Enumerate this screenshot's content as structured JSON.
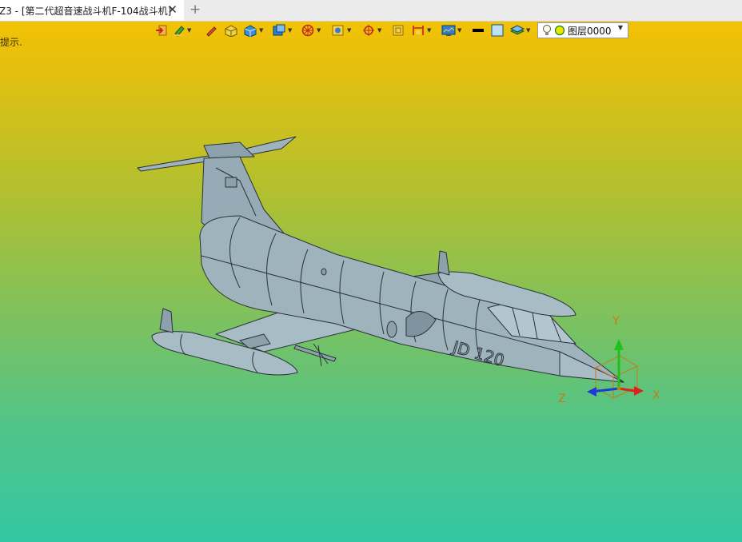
{
  "window": {
    "tab_title": "Z3 - [第二代超音速战斗机F-104战斗机]",
    "close_glyph": "✕",
    "new_tab_glyph": "+"
  },
  "prompt": {
    "text": "提示."
  },
  "toolbar": {
    "icons": [
      "exit-icon",
      "sketch-icon",
      "pen-icon",
      "box-icon",
      "solid-icon",
      "view-cube-icon",
      "wireframe-icon",
      "render-mode-icon",
      "origin-icon",
      "frame-icon",
      "dimension-icon",
      "display-icon",
      "line-color-icon",
      "fill-color-icon",
      "layer-stack-icon"
    ],
    "layer": {
      "label": "图层0000",
      "bulb_icon": "lightbulb-icon",
      "dot_color": "#e9e600"
    }
  },
  "axis": {
    "x_label": "X",
    "y_label": "Y",
    "z_label": "Z",
    "x_color": "#e0201a",
    "y_color": "#22c01f",
    "z_color": "#1e3bd6"
  },
  "model": {
    "markings": "JD 120",
    "fill_color": "#9fb3bd",
    "edge_color": "#2a3238"
  }
}
